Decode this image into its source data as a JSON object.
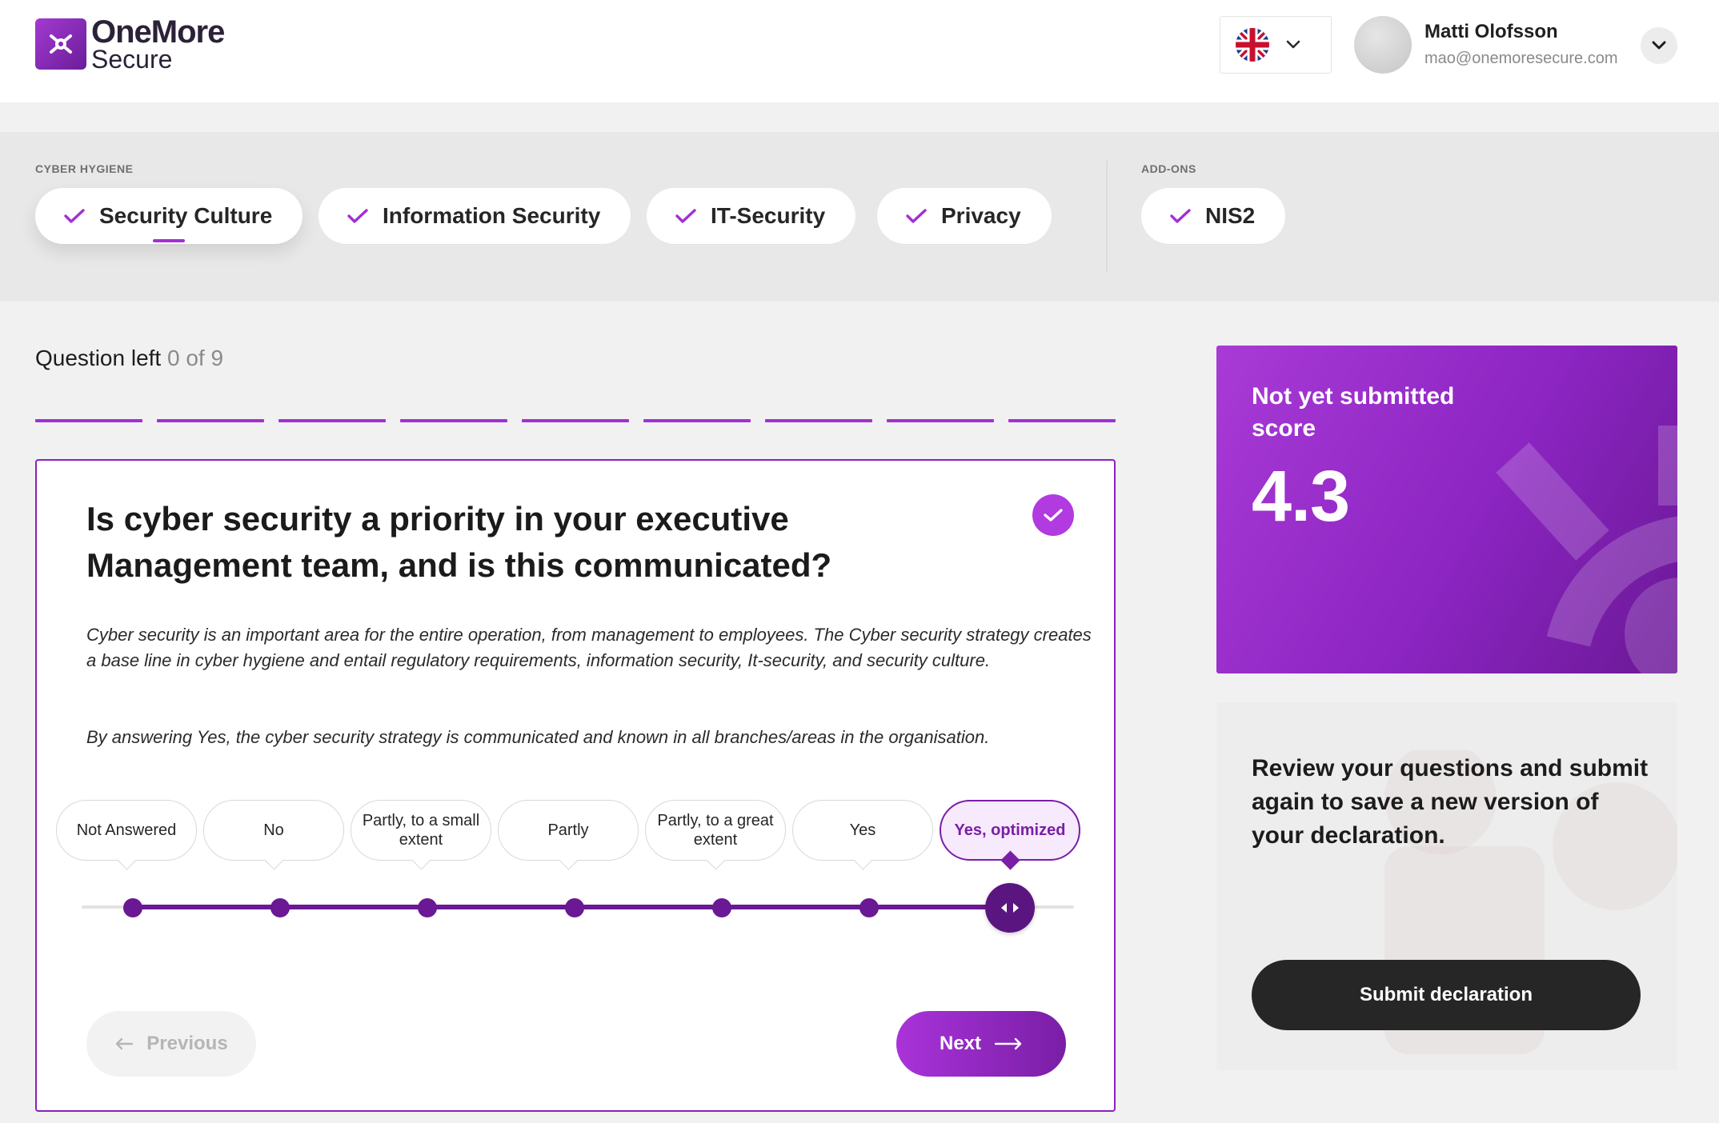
{
  "header": {
    "logo_top": "OneMore",
    "logo_bottom": "Secure",
    "language_flag": "uk-flag-icon",
    "user_name": "Matti Olofsson",
    "user_email": "mao@onemoresecure.com"
  },
  "categories": {
    "group_label": "CYBER HYGIENE",
    "items": [
      {
        "label": "Security Culture",
        "completed": true,
        "active": true
      },
      {
        "label": "Information Security",
        "completed": true,
        "active": false
      },
      {
        "label": "IT-Security",
        "completed": true,
        "active": false
      },
      {
        "label": "Privacy",
        "completed": true,
        "active": false
      }
    ],
    "addons_label": "ADD-ONS",
    "addons": [
      {
        "label": "NIS2",
        "completed": true
      }
    ]
  },
  "progress": {
    "label": "Question left",
    "count": "0 of 9",
    "segments_total": 9,
    "segments_done": 9
  },
  "question": {
    "title": "Is cyber security a priority in your executive Management team, and is this communicated?",
    "description": "Cyber security is an important area for the entire operation, from management to employees. The Cyber security strategy creates a base line in cyber hygiene and entail regulatory requirements, information security, It-security, and security culture.",
    "description2": "By answering Yes, the cyber security strategy is communicated and known in all branches/areas in the organisation.",
    "options": [
      "Not Answered",
      "No",
      "Partly, to a small extent",
      "Partly",
      "Partly, to a great extent",
      "Yes",
      "Yes, optimized"
    ],
    "selected_index": 6,
    "prev_label": "Previous",
    "next_label": "Next"
  },
  "score": {
    "label": "Not yet submitted score",
    "value": "4.3"
  },
  "review": {
    "text": "Review your questions and submit again to save a new version of your declaration.",
    "submit_label": "Submit declaration"
  },
  "colors": {
    "accent": "#a32fd4",
    "accent_dark": "#6a1893",
    "button_dark": "#262626"
  }
}
